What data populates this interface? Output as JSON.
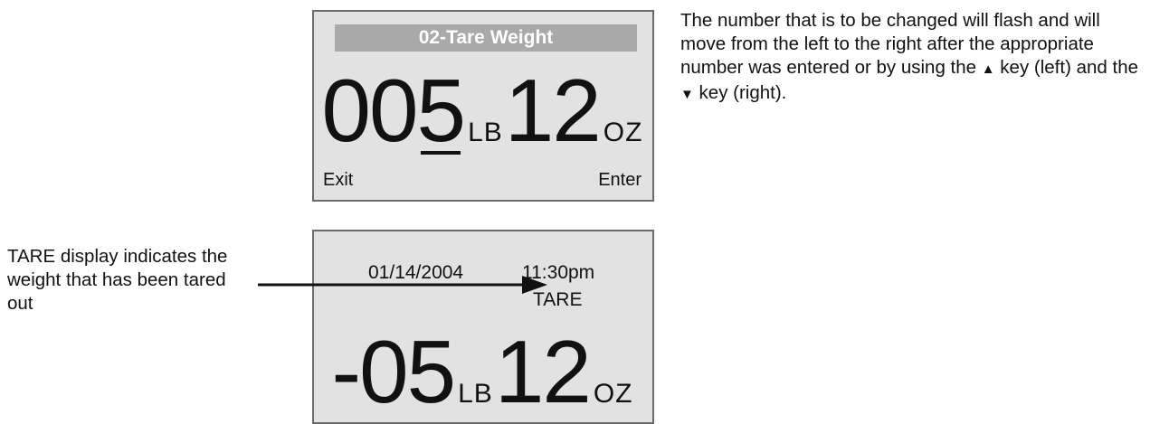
{
  "screen1": {
    "title": "02-Tare Weight",
    "pounds_part1": "00",
    "pounds_cursor_digit": "5",
    "pounds_unit": "LB",
    "ounces": "12",
    "ounces_unit": "OZ",
    "exit_label": "Exit",
    "enter_label": "Enter"
  },
  "screen2": {
    "date": "01/14/2004",
    "time": "11:30pm",
    "tare_label": "TARE",
    "pounds": "-05",
    "pounds_unit": "LB",
    "ounces": "12",
    "ounces_unit": "OZ"
  },
  "info": {
    "part1": "The number that is to be changed will flash and will move from the left to the right after the appropriate number was entered or by using the ",
    "up_symbol": "▲",
    "part2": " key (left) and the ",
    "down_symbol": "▼",
    "part3": " key (right)."
  },
  "callout": {
    "text": "TARE display indicates the weight that has been tared out"
  },
  "colors": {
    "screen_background": "#e2e2e2",
    "screen_border": "#6b6b6b",
    "title_bar": "#a9a9a9",
    "title_text": "#ffffff"
  }
}
